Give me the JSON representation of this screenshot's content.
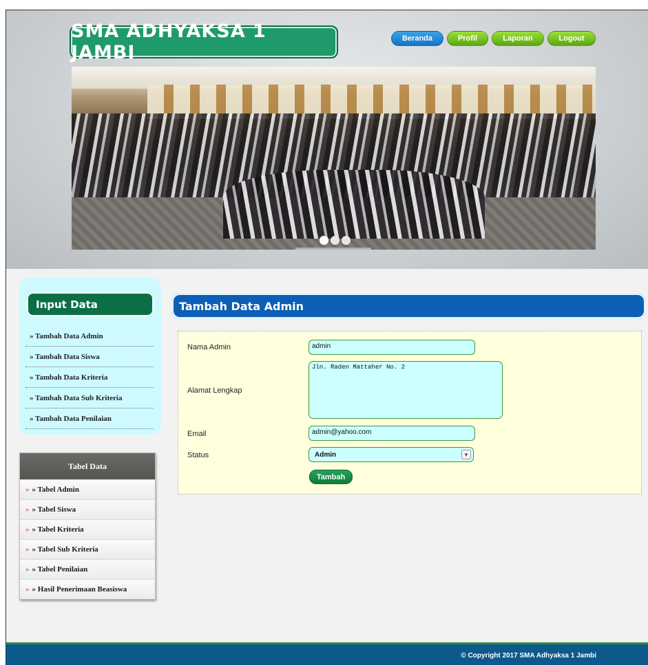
{
  "header": {
    "logo_text": "SMA ADHYAKSA 1 JAMBI",
    "nav": [
      "Beranda",
      "Profil",
      "Laporan",
      "Logout"
    ]
  },
  "sidebar": {
    "input_title": "Input Data",
    "input_items": [
      "» Tambah Data Admin",
      "» Tambah Data Siswa",
      "» Tambah Data Kriteria",
      "» Tambah Data Sub Kriteria",
      "» Tambah Data Penilaian"
    ],
    "tabel_title": "Tabel Data",
    "tabel_items": [
      "» Tabel Admin",
      "» Tabel Siswa",
      "» Tabel Kriteria",
      "» Tabel Sub Kriteria",
      "» Tabel Penilaian",
      "» Hasil Penerimaan Beasiswa"
    ]
  },
  "main": {
    "title": "Tambah Data Admin",
    "form": {
      "nama_label": "Nama Admin",
      "nama_value": "admin",
      "alamat_label": "Alamat Lengkap",
      "alamat_value": "Jln. Raden Mattaher No. 2",
      "email_label": "Email",
      "email_value": "admin@yahoo.com",
      "status_label": "Status",
      "status_value": "Admin",
      "submit_label": "Tambah"
    }
  },
  "footer": {
    "copyright": "© Copyright 2017 SMA Adhyaksa 1 Jambi"
  }
}
